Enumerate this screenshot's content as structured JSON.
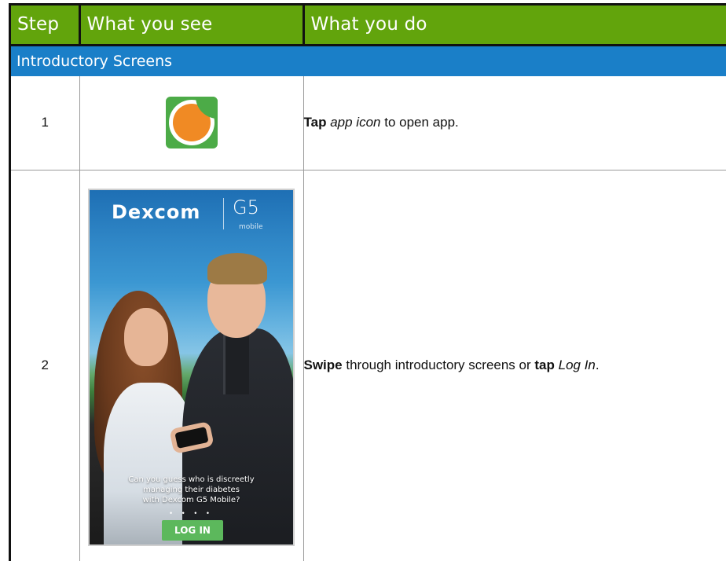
{
  "table": {
    "headers": {
      "step": "Step",
      "see": "What you see",
      "do": "What you do"
    },
    "section_title": "Introductory Screens",
    "rows": [
      {
        "step": "1",
        "do_bold": "Tap",
        "do_italic": "app icon",
        "do_rest": "to open app."
      },
      {
        "step": "2",
        "do_bold1": "Swipe",
        "do_mid": "through introductory screens or",
        "do_bold2": "tap",
        "do_italic": "Log In",
        "do_end": "."
      }
    ]
  },
  "phone_screen": {
    "brand": "Dexcom",
    "product": "G5",
    "product_sub": "mobile",
    "caption_line1": "Can you guess who is discreetly",
    "caption_line2": "managing their diabetes",
    "caption_line3": "with Dexcom G5 Mobile?",
    "dots": "• • • •",
    "login_button": "LOG IN"
  },
  "icons": {
    "app_icon": "dexcom-app-icon"
  },
  "colors": {
    "header_green": "#62a40c",
    "section_blue": "#1a7fc8",
    "app_icon_green": "#4cab47",
    "app_icon_orange": "#f08a24"
  }
}
